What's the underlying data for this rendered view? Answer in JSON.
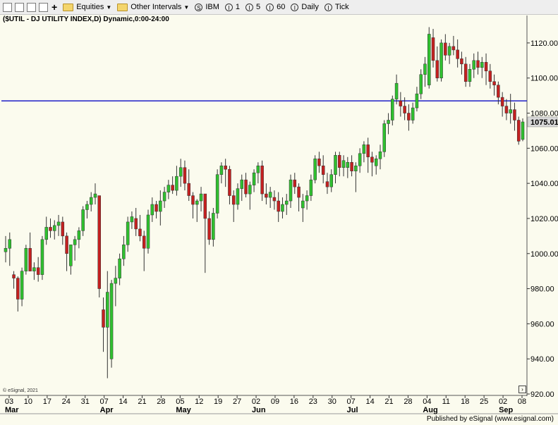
{
  "toolbar": {
    "equities_label": "Equities",
    "intervals_label": "Other Intervals",
    "symbol_label": "IBM",
    "interval_1": "1",
    "interval_5": "5",
    "interval_60": "60",
    "daily_label": "Daily",
    "tick_label": "Tick"
  },
  "chart_header": "($UTIL - DJ UTILITY INDEX,D) Dynamic,0:00-24:00",
  "credit": {
    "left": "© eSignal, 2021",
    "right": "Published by eSignal (www.esignal.com)"
  },
  "colors": {
    "up": "#2fc02f",
    "down": "#c42020",
    "wick": "#333333",
    "hline": "#1e1ec8",
    "background": "#fbfbee",
    "price_tag": "#d8d8d8"
  },
  "chart_data": {
    "type": "candlestick",
    "ylim": [
      920,
      1130
    ],
    "y_ticks": [
      920,
      940,
      960,
      980,
      1000,
      1020,
      1040,
      1060,
      1080,
      1100,
      1120
    ],
    "horizontal_line": 1087,
    "last_price_label": "1075.01",
    "x_tick_labels": [
      "03",
      "10",
      "17",
      "24",
      "31",
      "07",
      "14",
      "21",
      "28",
      "05",
      "12",
      "19",
      "27",
      "02",
      "09",
      "16",
      "23",
      "30",
      "07",
      "14",
      "21",
      "28",
      "04",
      "11",
      "18",
      "25",
      "02",
      "08"
    ],
    "month_labels": [
      "Mar",
      "Apr",
      "May",
      "Jun",
      "Jul",
      "Aug",
      "Sep"
    ],
    "candles": [
      [
        1001,
        1010,
        995,
        1003
      ],
      [
        1003,
        1012,
        993,
        1008
      ],
      [
        988,
        990,
        980,
        986
      ],
      [
        986,
        987,
        967,
        974
      ],
      [
        974,
        992,
        970,
        990
      ],
      [
        990,
        1005,
        988,
        1003
      ],
      [
        1003,
        1012,
        995,
        990
      ],
      [
        990,
        995,
        985,
        992
      ],
      [
        992,
        998,
        984,
        988
      ],
      [
        988,
        1010,
        985,
        1008
      ],
      [
        1008,
        1021,
        1005,
        1015
      ],
      [
        1015,
        1020,
        1009,
        1013
      ],
      [
        1013,
        1019,
        1008,
        1016
      ],
      [
        1016,
        1022,
        1010,
        1018
      ],
      [
        1018,
        1021,
        1005,
        1010
      ],
      [
        1010,
        1012,
        990,
        1000
      ],
      [
        993,
        1000,
        988,
        1005
      ],
      [
        1005,
        1010,
        996,
        1008
      ],
      [
        1008,
        1015,
        1003,
        1013
      ],
      [
        1013,
        1027,
        1010,
        1025
      ],
      [
        1025,
        1030,
        1020,
        1028
      ],
      [
        1028,
        1035,
        1024,
        1032
      ],
      [
        1032,
        1040,
        1028,
        1034
      ],
      [
        1033,
        1033,
        975,
        980
      ],
      [
        968,
        975,
        944,
        958
      ],
      [
        958,
        990,
        929,
        978
      ],
      [
        940,
        985,
        935,
        983
      ],
      [
        983,
        993,
        970,
        986
      ],
      [
        986,
        1000,
        982,
        997
      ],
      [
        997,
        1010,
        993,
        1005
      ],
      [
        1005,
        1021,
        1001,
        1018
      ],
      [
        1018,
        1024,
        1014,
        1021
      ],
      [
        1020,
        1026,
        1010,
        1014
      ],
      [
        1014,
        1022,
        1007,
        1010
      ],
      [
        1010,
        1013,
        990,
        1003
      ],
      [
        1003,
        1025,
        1000,
        1022
      ],
      [
        1022,
        1032,
        1018,
        1028
      ],
      [
        1028,
        1030,
        1020,
        1024
      ],
      [
        1024,
        1036,
        1016,
        1030
      ],
      [
        1030,
        1038,
        1026,
        1035
      ],
      [
        1035,
        1042,
        1031,
        1039
      ],
      [
        1039,
        1044,
        1034,
        1036
      ],
      [
        1036,
        1050,
        1033,
        1044
      ],
      [
        1044,
        1054,
        1038,
        1049
      ],
      [
        1049,
        1053,
        1036,
        1040
      ],
      [
        1040,
        1048,
        1030,
        1033
      ],
      [
        1033,
        1035,
        1020,
        1028
      ],
      [
        1028,
        1031,
        1018,
        1030
      ],
      [
        1030,
        1038,
        1024,
        1034
      ],
      [
        1034,
        1034,
        989,
        1020
      ],
      [
        1020,
        1024,
        1005,
        1008
      ],
      [
        1008,
        1026,
        1004,
        1023
      ],
      [
        1023,
        1048,
        1020,
        1045
      ],
      [
        1045,
        1052,
        1040,
        1050
      ],
      [
        1050,
        1054,
        1038,
        1048
      ],
      [
        1048,
        1050,
        1028,
        1033
      ],
      [
        1033,
        1036,
        1018,
        1028
      ],
      [
        1028,
        1040,
        1025,
        1037
      ],
      [
        1037,
        1045,
        1030,
        1042
      ],
      [
        1042,
        1046,
        1032,
        1034
      ],
      [
        1034,
        1041,
        1025,
        1039
      ],
      [
        1039,
        1048,
        1035,
        1046
      ],
      [
        1046,
        1052,
        1040,
        1050
      ],
      [
        1050,
        1053,
        1030,
        1034
      ],
      [
        1034,
        1040,
        1028,
        1032
      ],
      [
        1032,
        1038,
        1026,
        1035
      ],
      [
        1032,
        1036,
        1025,
        1030
      ],
      [
        1030,
        1035,
        1018,
        1024
      ],
      [
        1024,
        1032,
        1020,
        1028
      ],
      [
        1028,
        1034,
        1022,
        1030
      ],
      [
        1030,
        1045,
        1026,
        1042
      ],
      [
        1042,
        1046,
        1034,
        1038
      ],
      [
        1038,
        1040,
        1024,
        1032
      ],
      [
        1026,
        1034,
        1018,
        1030
      ],
      [
        1030,
        1036,
        1025,
        1033
      ],
      [
        1033,
        1045,
        1030,
        1042
      ],
      [
        1042,
        1056,
        1040,
        1054
      ],
      [
        1054,
        1058,
        1046,
        1050
      ],
      [
        1050,
        1056,
        1040,
        1045
      ],
      [
        1041,
        1046,
        1034,
        1038
      ],
      [
        1038,
        1048,
        1035,
        1045
      ],
      [
        1045,
        1058,
        1040,
        1056
      ],
      [
        1056,
        1058,
        1044,
        1049
      ],
      [
        1049,
        1056,
        1044,
        1053
      ],
      [
        1049,
        1055,
        1043,
        1052
      ],
      [
        1052,
        1056,
        1044,
        1047
      ],
      [
        1047,
        1052,
        1035,
        1050
      ],
      [
        1050,
        1060,
        1046,
        1057
      ],
      [
        1057,
        1064,
        1052,
        1062
      ],
      [
        1062,
        1066,
        1046,
        1055
      ],
      [
        1055,
        1058,
        1044,
        1052
      ],
      [
        1050,
        1056,
        1045,
        1054
      ],
      [
        1054,
        1062,
        1048,
        1058
      ],
      [
        1058,
        1076,
        1055,
        1074
      ],
      [
        1074,
        1080,
        1068,
        1076
      ],
      [
        1076,
        1090,
        1073,
        1088
      ],
      [
        1088,
        1102,
        1085,
        1097
      ],
      [
        1087,
        1092,
        1078,
        1084
      ],
      [
        1084,
        1089,
        1076,
        1080
      ],
      [
        1080,
        1085,
        1070,
        1076
      ],
      [
        1076,
        1086,
        1074,
        1083
      ],
      [
        1083,
        1095,
        1081,
        1091
      ],
      [
        1091,
        1105,
        1088,
        1102
      ],
      [
        1102,
        1112,
        1095,
        1108
      ],
      [
        1096,
        1129,
        1094,
        1125
      ],
      [
        1123,
        1128,
        1106,
        1110
      ],
      [
        1110,
        1118,
        1098,
        1100
      ],
      [
        1100,
        1122,
        1098,
        1120
      ],
      [
        1120,
        1125,
        1110,
        1113
      ],
      [
        1113,
        1120,
        1108,
        1118
      ],
      [
        1118,
        1124,
        1113,
        1116
      ],
      [
        1116,
        1122,
        1106,
        1111
      ],
      [
        1111,
        1115,
        1102,
        1108
      ],
      [
        1108,
        1112,
        1095,
        1098
      ],
      [
        1098,
        1108,
        1095,
        1105
      ],
      [
        1105,
        1114,
        1100,
        1110
      ],
      [
        1110,
        1115,
        1102,
        1106
      ],
      [
        1106,
        1112,
        1100,
        1109
      ],
      [
        1109,
        1114,
        1096,
        1104
      ],
      [
        1104,
        1108,
        1094,
        1098
      ],
      [
        1098,
        1102,
        1090,
        1096
      ],
      [
        1096,
        1098,
        1085,
        1089
      ],
      [
        1089,
        1092,
        1078,
        1084
      ],
      [
        1084,
        1088,
        1076,
        1080
      ],
      [
        1080,
        1091,
        1074,
        1082
      ],
      [
        1082,
        1086,
        1070,
        1076
      ],
      [
        1076,
        1078,
        1062,
        1064
      ],
      [
        1065,
        1077,
        1064,
        1075
      ]
    ]
  }
}
